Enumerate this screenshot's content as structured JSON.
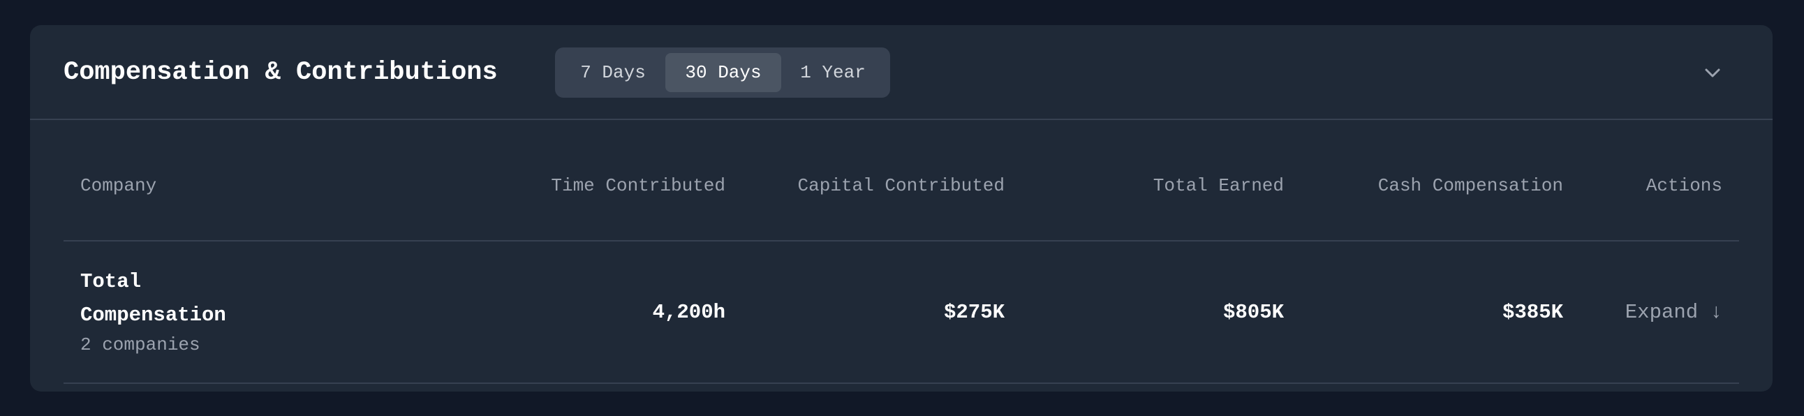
{
  "header": {
    "title": "Compensation & Contributions",
    "periods": [
      "7 Days",
      "30 Days",
      "1 Year"
    ],
    "active_period": "30 Days",
    "collapse_icon": "chevron-down-icon"
  },
  "table": {
    "columns": {
      "company": "Company",
      "time": "Time Contributed",
      "capital": "Capital Contributed",
      "earned": "Total Earned",
      "cash": "Cash Compensation",
      "actions": "Actions"
    },
    "rows": [
      {
        "company": "Total Compensation",
        "subtitle": "2 companies",
        "time": "4,200h",
        "capital": "$275K",
        "earned": "$805K",
        "cash": "$385K",
        "action": "Expand ↓"
      }
    ]
  },
  "colors": {
    "page_bg": "#111827",
    "card_bg": "#1f2937",
    "segment_bg": "#374151",
    "segment_active_bg": "#4b5563",
    "muted_text": "#9ca3af",
    "primary_text": "#ffffff"
  }
}
